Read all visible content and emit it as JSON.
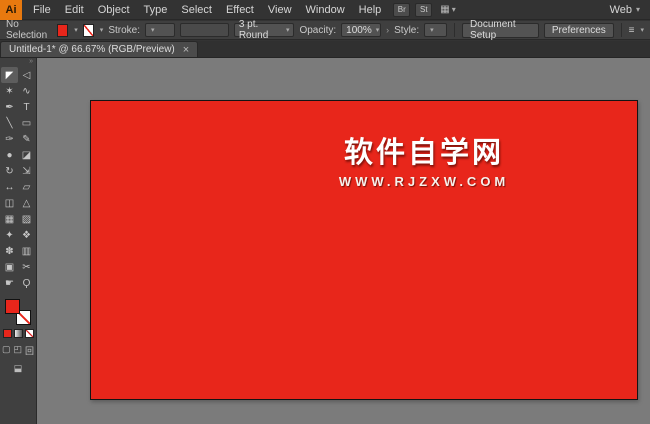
{
  "colors": {
    "artboard_red": "#e8261b",
    "fill_red": "#e8261b",
    "canvas_gray": "#7b7b7b"
  },
  "menubar": {
    "logo": "Ai",
    "items": [
      "File",
      "Edit",
      "Object",
      "Type",
      "Select",
      "Effect",
      "View",
      "Window",
      "Help"
    ],
    "buttons": [
      "Br",
      "St"
    ],
    "arrange_icon": "▦",
    "workspace": "Web",
    "caret": "▾"
  },
  "controlbar": {
    "selection_label": "No Selection",
    "stroke_label": "Stroke:",
    "brush_value": "3 pt. Round",
    "opacity_label": "Opacity:",
    "opacity_value": "100%",
    "style_label": "Style:",
    "chevron": "›",
    "doc_setup_label": "Document Setup",
    "preferences_label": "Preferences",
    "align_icon": "≡",
    "caret": "▾"
  },
  "tabbar": {
    "title": "Untitled-1* @ 66.67% (RGB/Preview)",
    "close": "×"
  },
  "toolbar": {
    "collapse_icon": "»",
    "tools": [
      {
        "name": "selection-tool",
        "glyph": "◤"
      },
      {
        "name": "direct-selection-tool",
        "glyph": "◁"
      },
      {
        "name": "magic-wand-tool",
        "glyph": "✶"
      },
      {
        "name": "lasso-tool",
        "glyph": "∿"
      },
      {
        "name": "pen-tool",
        "glyph": "✒"
      },
      {
        "name": "type-tool",
        "glyph": "T"
      },
      {
        "name": "line-segment-tool",
        "glyph": "╲"
      },
      {
        "name": "rectangle-tool",
        "glyph": "▭"
      },
      {
        "name": "paintbrush-tool",
        "glyph": "✑"
      },
      {
        "name": "pencil-tool",
        "glyph": "✎"
      },
      {
        "name": "blob-brush-tool",
        "glyph": "●"
      },
      {
        "name": "eraser-tool",
        "glyph": "◪"
      },
      {
        "name": "rotate-tool",
        "glyph": "↻"
      },
      {
        "name": "scale-tool",
        "glyph": "⇲"
      },
      {
        "name": "width-tool",
        "glyph": "↔"
      },
      {
        "name": "free-transform-tool",
        "glyph": "▱"
      },
      {
        "name": "shape-builder-tool",
        "glyph": "◫"
      },
      {
        "name": "perspective-grid-tool",
        "glyph": "△"
      },
      {
        "name": "mesh-tool",
        "glyph": "▦"
      },
      {
        "name": "gradient-tool",
        "glyph": "▨"
      },
      {
        "name": "eyedropper-tool",
        "glyph": "✦"
      },
      {
        "name": "blend-tool",
        "glyph": "❖"
      },
      {
        "name": "symbol-sprayer-tool",
        "glyph": "✽"
      },
      {
        "name": "column-graph-tool",
        "glyph": "▥"
      },
      {
        "name": "artboard-tool",
        "glyph": "▣"
      },
      {
        "name": "slice-tool",
        "glyph": "✂"
      },
      {
        "name": "hand-tool",
        "glyph": "☛"
      },
      {
        "name": "zoom-tool",
        "glyph": "Ϙ"
      }
    ]
  },
  "canvas": {
    "watermark": {
      "title": "软件自学网",
      "url": "WWW.RJZXW.COM"
    }
  }
}
